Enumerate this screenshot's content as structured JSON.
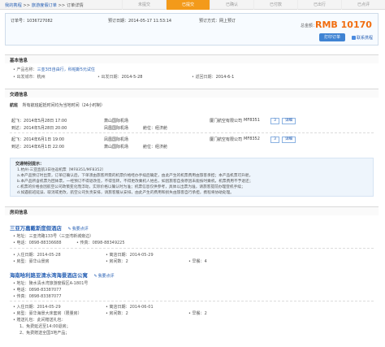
{
  "breadcrumb": {
    "home": "我的携程",
    "orders": "旅游度假订单",
    "current": "订单详情",
    "sep": ">>"
  },
  "steps": [
    "未提交",
    "已提交",
    "已确认",
    "已付款",
    "已出行",
    "已点评"
  ],
  "summary": {
    "order_no": "订单号：1036727082",
    "order_date": "预订日期：2014-05-17 11:53:14",
    "booking_method": "预订方式：网上预订",
    "total_label": "总金额：",
    "total_value": "RMB 10170",
    "print": "打印订单",
    "contact": "联系携程"
  },
  "basic": {
    "header": "基本信息",
    "product_label": "产品名称：",
    "product_value": "三亚3日自由行，科帕斯5元试住",
    "city_label": "出发城市：",
    "city_value": "杭州",
    "depart_label": "出发日期：",
    "depart_value": "2014-5-28",
    "return_label": "返回日期：",
    "return_value": "2014-6-1"
  },
  "traffic": {
    "header": "交通信息",
    "plane_tag": "航班",
    "plane_note": "所有航班起抵时间均为当地时间（24小时制）",
    "flights": [
      {
        "dep_label": "起飞：",
        "dep_time": "2014年5月28日 17:00",
        "dep_airport": "萧山国际机场",
        "airline": "厦门航空有限公司",
        "flight_no": "MF8351",
        "arr_label": "到达：",
        "arr_time": "2014年5月28日 20:00",
        "arr_airport": "凤凰国际机场",
        "seat": "舱位：经济舱",
        "tag1": "3",
        "tag2": "详细"
      },
      {
        "dep_label": "起飞：",
        "dep_time": "2014年6月1日 19:00",
        "dep_airport": "凤凰国际机场",
        "airline": "厦门航空有限公司",
        "flight_no": "MF8352",
        "arr_label": "到达：",
        "arr_time": "2014年6月1日 22:00",
        "arr_airport": "萧山国际机场",
        "seat": "舱位：经济舱",
        "tag1": "3",
        "tag2": "详细"
      }
    ],
    "notice_title": "交通特别提示：",
    "notice_lines": [
      "1.杭州-三亚直航3日往返机票（MF8351/MF8352）",
      "a.本产品预订时出票，订单已确认后，下单须由旅客所需的机票价格经办手续后确定，由此产生的机票费用由旅客承担；本产品机票可升舱，",
      "b.本产品所含机票为团体票，一经预订不得退改签，不得签转，不得更改乘机人姓名，如因旅客自身原因未能按时乘机，机票费用不予退还；",
      "c.机票的价格会因航空公司政策变化而浮动，实际价格以确认时为准；机票信息仅供参考，具体以出票为准，请旅客提前办理登机手续；",
      "d.如遇航班延误、取消或更改，航空公司负责安排，请旅客服从安排，由此产生的费用和损失由旅客自行承担，携程将协助处理。"
    ]
  },
  "hotel": {
    "header": "房间信息",
    "review": "我要点评",
    "items": [
      {
        "name": "三亚万嘉戴斯度假酒店",
        "addr_label": "地址：",
        "addr": "三亚湾路133号（三亚湾新城旁边）",
        "tel_label": "电话：",
        "tel": "0898-88336688",
        "fax_label": "传真：",
        "fax": "0898-88349225",
        "checkin_label": "入住日期：",
        "checkin": "2014-05-28",
        "checkout_label": "离店日期：",
        "checkout": "2014-05-29",
        "room_label": "房型：",
        "room": "豪华山景房",
        "count_label": "房间数：",
        "count": "2",
        "bed_label": "早餐：",
        "bed": "4"
      },
      {
        "name": "海南哈利路亚清水湾海景酒店公寓",
        "addr_label": "地址：",
        "addr": "陵水清水湾旅游度假区A-1801号",
        "tel_label": "电话：",
        "tel": "0898-83387077",
        "fax_label": "传真：",
        "fax": "0898-83387077",
        "checkin_label": "入住日期：",
        "checkin": "2014-05-29",
        "checkout_label": "离店日期：",
        "checkout": "2014-06-01",
        "room_label": "房型：",
        "room": "豪华海景大床套房（限量房）",
        "count_label": "房间数：",
        "count": "2",
        "bed_label": "早餐：",
        "bed": "2",
        "extra_label": "赠送礼包：",
        "extra_value": "此间赠送礼包：",
        "gifts": [
          "1、免费延迟至14:00退房；",
          "2、免费赠送全国3地产品；"
        ]
      }
    ]
  }
}
